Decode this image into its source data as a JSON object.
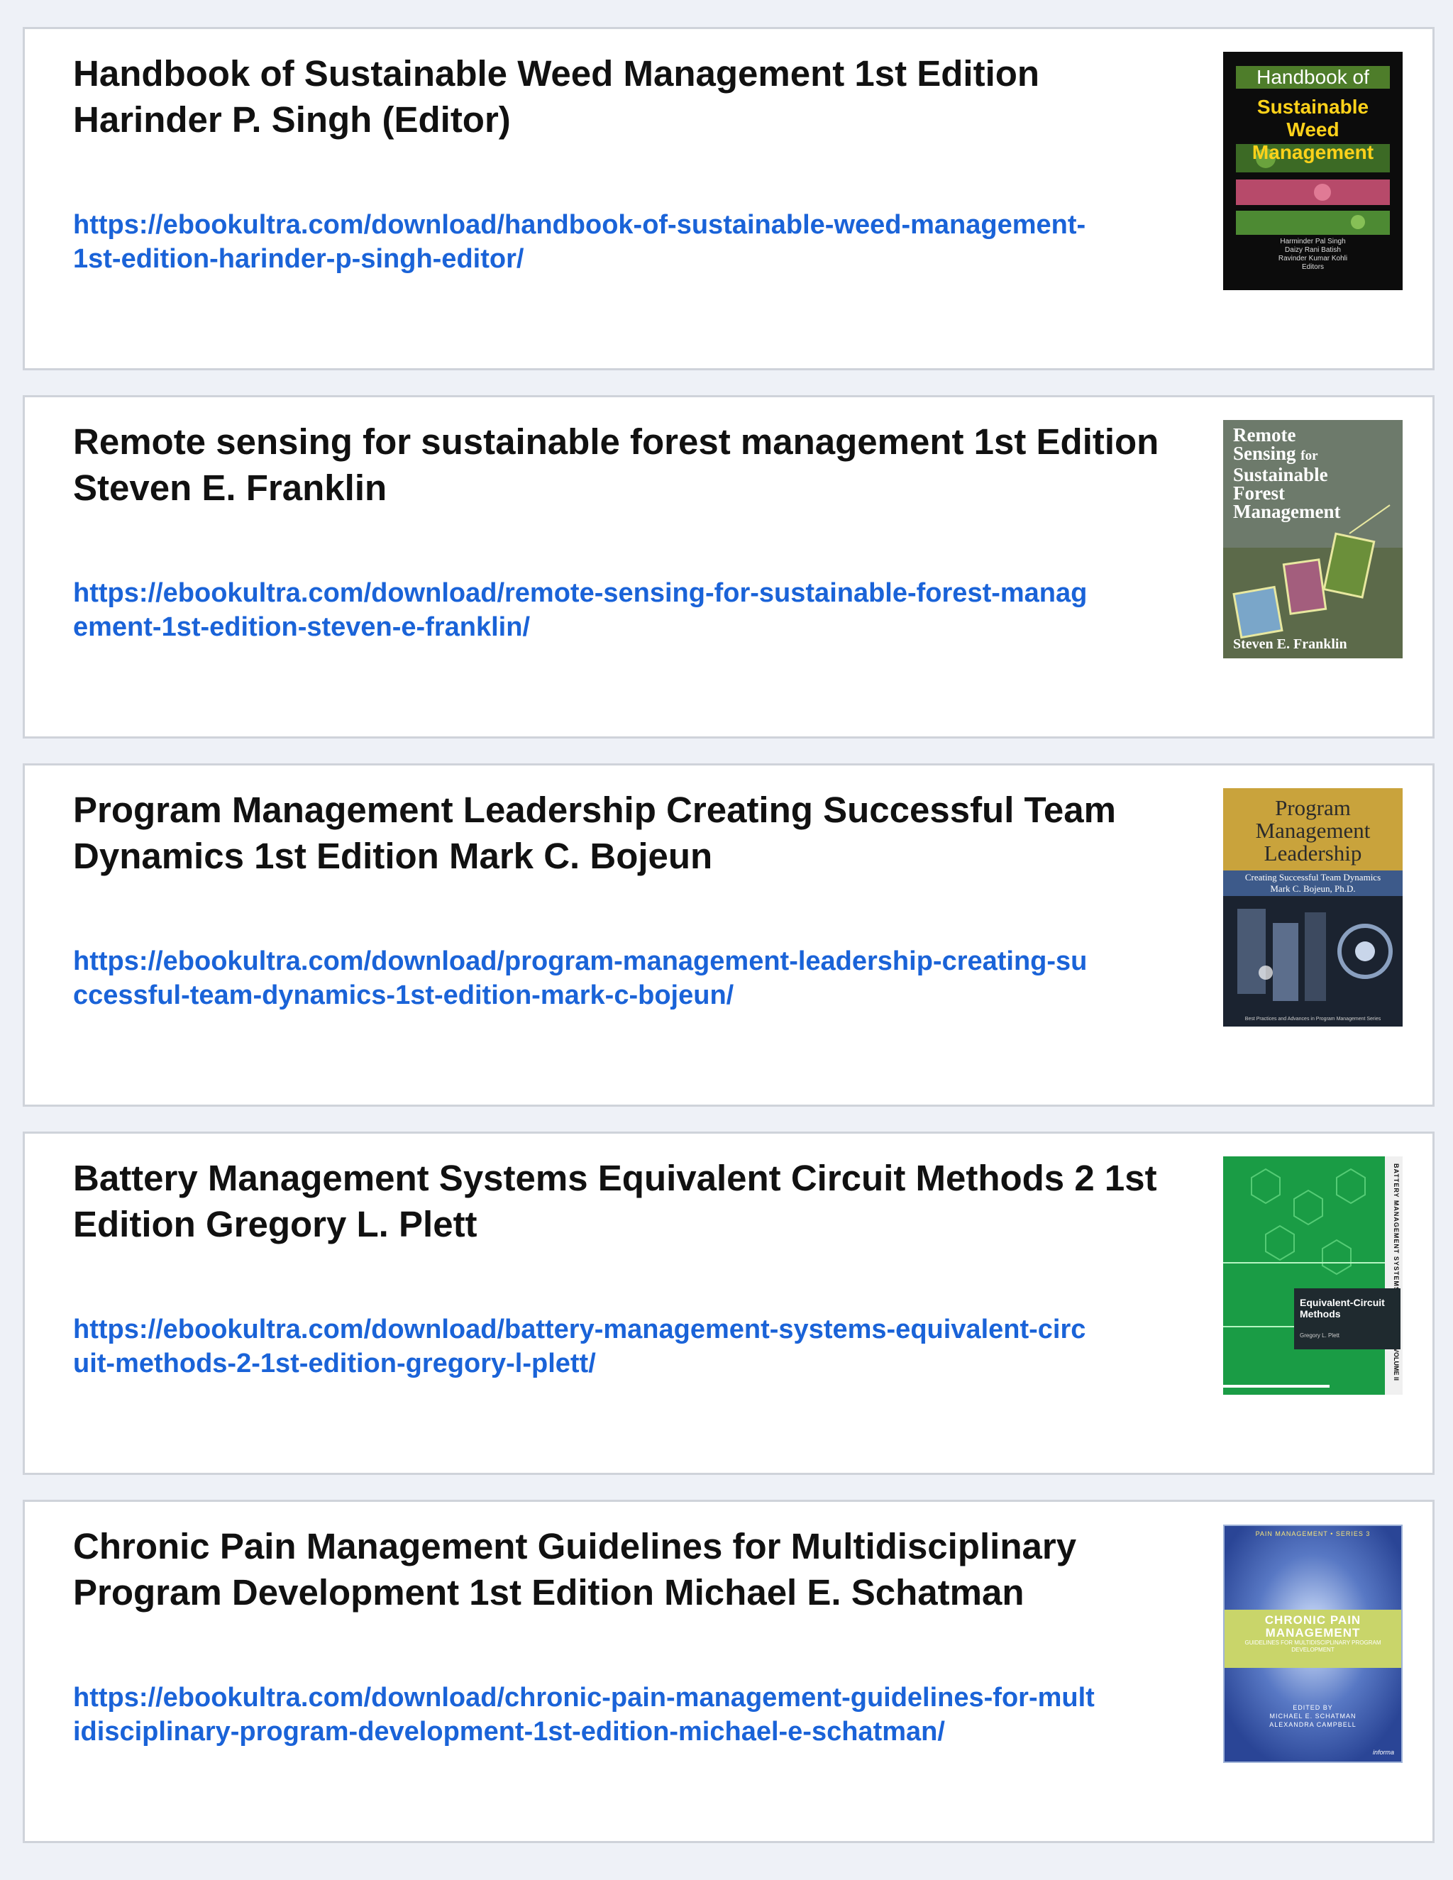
{
  "books": [
    {
      "title": "Handbook of Sustainable Weed Management 1st Edition Harinder P. Singh (Editor)",
      "url": "https://ebookultra.com/download/handbook-of-sustainable-weed-management-1st-edition-harinder-p-singh-editor/",
      "cover": {
        "line1": "Handbook of",
        "line2": "Sustainable",
        "line3": "Weed Management",
        "authors": "Harminder Pal Singh\nDaizy Rani Batish\nRavinder Kumar Kohli\nEditors"
      }
    },
    {
      "title": "Remote sensing for sustainable forest management 1st Edition Steven E. Franklin",
      "url": "https://ebookultra.com/download/remote-sensing-for-sustainable-forest-management-1st-edition-steven-e-franklin/",
      "cover": {
        "line1": "Remote",
        "line2a": "Sensing",
        "line2b": "for",
        "line3": "Sustainable",
        "line4": "Forest",
        "line5": "Management",
        "author": "Steven E. Franklin"
      }
    },
    {
      "title": "Program Management Leadership Creating Successful Team Dynamics 1st Edition Mark C. Bojeun",
      "url": "https://ebookultra.com/download/program-management-leadership-creating-successful-team-dynamics-1st-edition-mark-c-bojeun/",
      "cover": {
        "line1": "Program",
        "line2": "Management",
        "line3": "Leadership",
        "subtitle": "Creating Successful Team Dynamics",
        "author": "Mark C. Bojeun, Ph.D.",
        "series": "Best Practices and Advances in Program Management Series"
      }
    },
    {
      "title": "Battery Management Systems Equivalent Circuit Methods 2 1st Edition Gregory L. Plett",
      "url": "https://ebookultra.com/download/battery-management-systems-equivalent-circuit-methods-2-1st-edition-gregory-l-plett/",
      "cover": {
        "spine": "BATTERY MANAGEMENT SYSTEMS",
        "volume": "VOLUME II",
        "box_title": "Equivalent-Circuit Methods",
        "author": "Gregory L. Plett"
      }
    },
    {
      "title": "Chronic Pain Management Guidelines for Multidisciplinary Program Development 1st Edition Michael E. Schatman",
      "url": "https://ebookultra.com/download/chronic-pain-management-guidelines-for-multidisciplinary-program-development-1st-edition-michael-e-schatman/",
      "cover": {
        "series": "PAIN MANAGEMENT • SERIES 3",
        "line1": "CHRONIC PAIN",
        "line2": "MANAGEMENT",
        "subtitle": "GUIDELINES FOR MULTIDISCIPLINARY PROGRAM DEVELOPMENT",
        "edited": "EDITED BY",
        "editor1": "MICHAEL E. SCHATMAN",
        "editor2": "ALEXANDRA CAMPBELL",
        "publisher": "informa"
      }
    }
  ],
  "colors": {
    "page_background": "#eef1f7",
    "card_border": "#cfd3da",
    "link": "#1a63d8",
    "title": "#111111"
  }
}
